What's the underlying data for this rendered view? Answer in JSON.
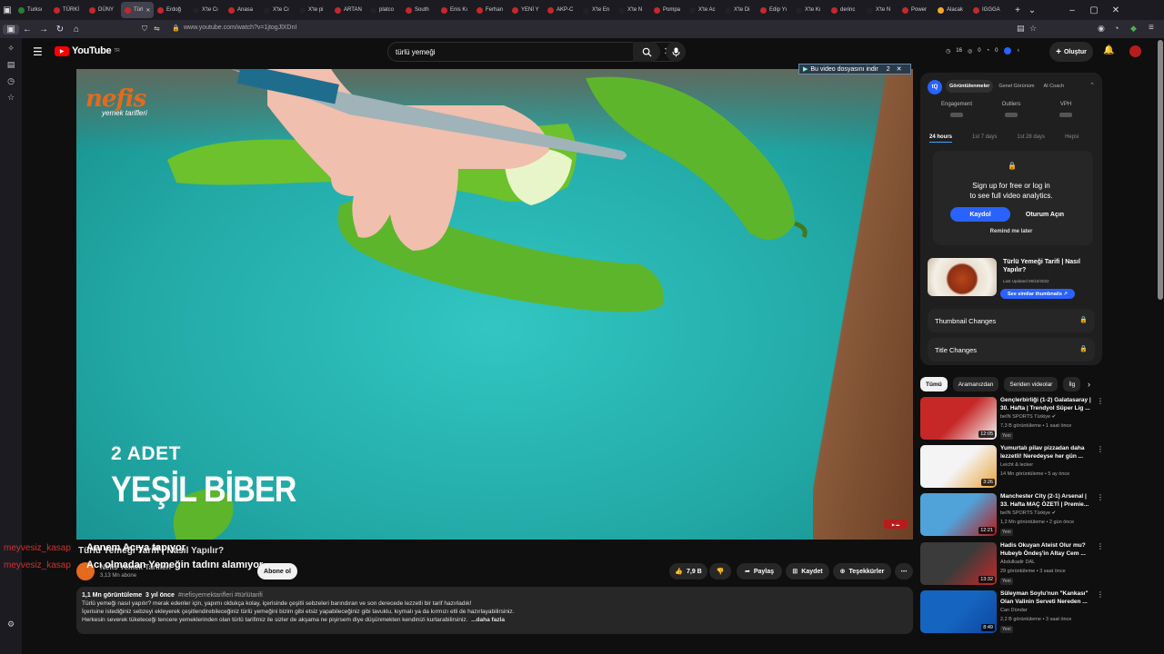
{
  "browser": {
    "tabs": [
      "Turksı",
      "TÜRKİ",
      "DÜNY",
      "Türl",
      "Erdoğ",
      "X'te Cı",
      "Anasa",
      "X'te Cı",
      "X'te pi",
      "ARTAN",
      "platco",
      "South",
      "Enis Kı",
      "Ferhan",
      "YENİ Y",
      "AKP-C",
      "X'te En",
      "X'te N",
      "Pompa",
      "X'te Ac",
      "X'te Di",
      "Edip Yı",
      "X'te Kı",
      "derinc",
      "X'te N",
      "Power",
      "Alacak",
      "IGGGA"
    ],
    "active_tab": "Türl",
    "url": "www.youtube.com/watch?v=1jtogJlXDnI"
  },
  "header": {
    "logo_text": "YouTube",
    "logo_sup": "TR",
    "search_value": "türlü yemeği",
    "stats": [
      "16",
      "0",
      "0"
    ],
    "create_label": "Oluştur"
  },
  "player": {
    "brand_name": "nefis",
    "brand_sub": "yemek tarifleri",
    "qty_text": "2 ADET",
    "ingredient_text": "YEŞİL BİBER",
    "download_banner": "Bu video dosyasını indir",
    "download_extra": "2"
  },
  "video": {
    "overlay_user1": "meyvesiz_kasap",
    "overlay_msg1": "Annem Acıya tapıyor",
    "overlay_user2": "meyvesiz_kasap",
    "overlay_msg2": "Acı olmadan Yemeğin tadını alamıyor",
    "title": "Türlü Yemeği Tarifi | Nasıl Yapılır?",
    "channel": "Nefis Yemek Tarifleri",
    "subscribers": "3,13 Mn abone",
    "subscribe_label": "Abone ol",
    "likes": "7,9 B",
    "share_label": "Paylaş",
    "save_label": "Kaydet",
    "thanks_label": "Teşekkürler",
    "desc_views": "1,1 Mn görüntüleme",
    "desc_date": "3 yıl önce",
    "desc_tags": "#nefisyemektarifleri #türlütarifi",
    "desc_line1": "Türlü yemeği nasıl yapılır? merak edenler için, yapımı oldukça kolay, içerisinde çeşitli sebzeleri barındıran ve son derecede lezzetli bir tarif hazırladık!",
    "desc_line2": "İçerisine istediğiniz sebzeyi ekleyerek çeşitlendirebileceğiniz türlü yemeğini bizim gibi etsiz yapabileceğiniz gibi tavuklu, kıymalı ya da kırmızı etli de hazırlayabilirsiniz.",
    "desc_line3": "Herkesin severek tüketeceği tencere yemeklerinden olan türlü tarifimiz ile sizler de akşama ne pişirsem diye düşünmekten kendinizi kurtarabilirsiniz.",
    "desc_more": "...daha fazla"
  },
  "analytics": {
    "tabs": [
      "Görüntülenmeler",
      "Genel Görünüm",
      "AI Coach"
    ],
    "metrics": [
      "Engagement",
      "Outliers",
      "VPH"
    ],
    "ranges": [
      "24 hours",
      "1st 7 days",
      "1st 28 days",
      "Hepsi"
    ],
    "lock_line1": "Sign up for free or log in",
    "lock_line2": "to see full video analytics.",
    "signup_label": "Kaydol",
    "login_label": "Oturum Açın",
    "remind_label": "Remind me later",
    "promo_title": "Türlü Yemeği Tarifi | Nasıl Yapılır?",
    "promo_updated": "Last Updated 09/22/2022",
    "promo_button": "See similar thumbnails",
    "row1": "Thumbnail Changes",
    "row2": "Title Changes"
  },
  "chips": [
    "Tümü",
    "Aramanızdan",
    "Seriden videolar",
    "İlg"
  ],
  "recommendations": [
    {
      "title": "Gençlerbirliği (1-2) Galatasaray | 30. Hafta | Trendyol Süper Lig ...",
      "channel": "beIN SPORTS Türkiye ✔",
      "meta": "7,3 B görüntüleme • 1 saat önce",
      "badge": "Yeni",
      "duration": "12:05",
      "colors": [
        "#c62828",
        "#f5f5f5"
      ]
    },
    {
      "title": "Yumurtalı pilav pizzadan daha lezzetli! Neredeyse her gün ...",
      "channel": "Leicht & lecker",
      "meta": "14 Mn görüntüleme • 5 ay önce",
      "badge": "",
      "duration": "3:26",
      "colors": [
        "#f4f4f4",
        "#e9a43a"
      ]
    },
    {
      "title": "Manchester City (2-1) Arsenal | 33. Hafta MAÇ ÖZETİ | Premie...",
      "channel": "beIN SPORTS Türkiye ✔",
      "meta": "1,2 Mn görüntüleme • 2 gün önce",
      "badge": "Yeni",
      "duration": "12:21",
      "colors": [
        "#4fa3d9",
        "#b71c1c"
      ]
    },
    {
      "title": "Hadis Okuyan Ateist Olur mu? Hubeyb Öndeş'in Altay Cem ...",
      "channel": "Abdulkadir DAL",
      "meta": "29 görüntüleme • 3 saat önce",
      "badge": "Yeni",
      "duration": "13:32",
      "colors": [
        "#3b3b3b",
        "#c62828"
      ]
    },
    {
      "title": "Süleyman Soylu'nun \"Kankası\" Olan Valinin Serveti Nereden ...",
      "channel": "Can Dündar",
      "meta": "2,2 B görüntüleme • 3 saat önce",
      "badge": "Yeni",
      "duration": "8:49",
      "colors": [
        "#1565c0",
        "#0d47a1"
      ]
    }
  ],
  "colors": {
    "youtube_red": "#ff0000",
    "accent_blue": "#2962ff",
    "overlay_red": "#d32f2f"
  }
}
